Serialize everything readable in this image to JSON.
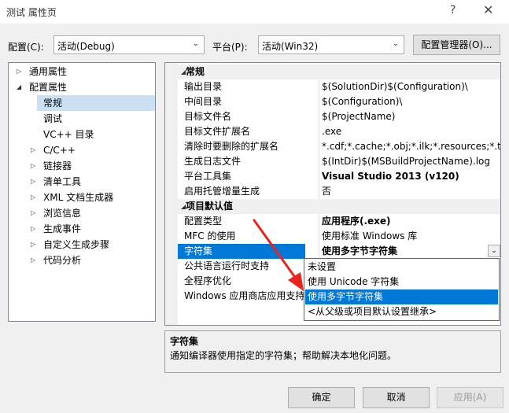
{
  "window": {
    "title": "测试 属性页",
    "help_glyph": "?",
    "close_glyph": "✕"
  },
  "toolbar": {
    "config_label": "配置(C):",
    "config_value": "活动(Debug)",
    "platform_label": "平台(P):",
    "platform_value": "活动(Win32)",
    "config_manager_label": "配置管理器(O)..."
  },
  "tree": {
    "items": [
      {
        "label": "通用属性"
      },
      {
        "label": "配置属性"
      },
      {
        "label": "常规"
      },
      {
        "label": "调试"
      },
      {
        "label": "VC++ 目录"
      },
      {
        "label": "C/C++"
      },
      {
        "label": "链接器"
      },
      {
        "label": "清单工具"
      },
      {
        "label": "XML 文档生成器"
      },
      {
        "label": "浏览信息"
      },
      {
        "label": "生成事件"
      },
      {
        "label": "自定义生成步骤"
      },
      {
        "label": "代码分析"
      }
    ]
  },
  "grid": {
    "cat_general": "常规",
    "general_rows": [
      {
        "name": "输出目录",
        "value": "$(SolutionDir)$(Configuration)\\"
      },
      {
        "name": "中间目录",
        "value": "$(Configuration)\\"
      },
      {
        "name": "目标文件名",
        "value": "$(ProjectName)"
      },
      {
        "name": "目标文件扩展名",
        "value": ".exe"
      },
      {
        "name": "清除时要删除的扩展名",
        "value": "*.cdf;*.cache;*.obj;*.ilk;*.resources;*.tlb;*.tli;*.t"
      },
      {
        "name": "生成日志文件",
        "value": "$(IntDir)$(MSBuildProjectName).log"
      },
      {
        "name": "平台工具集",
        "value": "Visual Studio 2013 (v120)"
      },
      {
        "name": "启用托管增量生成",
        "value": "否"
      }
    ],
    "cat_defaults": "项目默认值",
    "default_rows": [
      {
        "name": "配置类型",
        "value": "应用程序(.exe)"
      },
      {
        "name": "MFC 的使用",
        "value": "使用标准 Windows 库"
      },
      {
        "name": "字符集",
        "value": "使用多字节字符集"
      },
      {
        "name": "公共语言运行时支持",
        "value": ""
      },
      {
        "name": "全程序优化",
        "value": ""
      },
      {
        "name": "Windows 应用商店应用支持",
        "value": ""
      }
    ]
  },
  "dropdown": {
    "options": [
      "未设置",
      "使用 Unicode 字符集",
      "使用多字节字符集",
      "<从父级或项目默认设置继承>"
    ],
    "selected": "使用多字节字符集"
  },
  "description": {
    "title": "字符集",
    "text": "通知编译器使用指定的字符集；帮助解决本地化问题。"
  },
  "buttons": {
    "ok": "确定",
    "cancel": "取消",
    "apply": "应用(A)"
  },
  "colors": {
    "selection": "#0078d7",
    "arrow": "#e8241c",
    "tree_selection": "#cce0f4"
  }
}
